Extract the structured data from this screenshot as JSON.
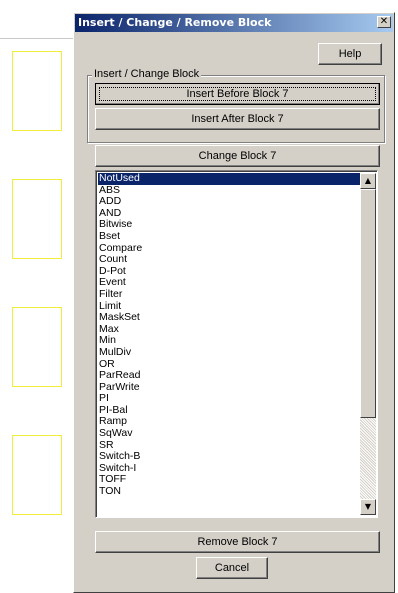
{
  "dialog": {
    "title": "Insert / Change / Remove Block",
    "close_glyph": "✕"
  },
  "buttons": {
    "help": "Help",
    "insert_before": "Insert Before Block 7",
    "insert_after": "Insert After Block 7",
    "change": "Change Block 7",
    "remove": "Remove Block 7",
    "cancel": "Cancel"
  },
  "group": {
    "label": "Insert / Change Block"
  },
  "block_list": {
    "selected": "NotUsed",
    "items": [
      "NotUsed",
      "ABS",
      "ADD",
      "AND",
      "Bitwise",
      "Bset",
      "Compare",
      "Count",
      "D-Pot",
      "Event",
      "Filter",
      "Limit",
      "MaskSet",
      "Max",
      "Min",
      "MulDiv",
      "OR",
      "ParRead",
      "ParWrite",
      "PI",
      "PI-Bal",
      "Ramp",
      "SqWav",
      "SR",
      "Switch-B",
      "Switch-I",
      "TOFF",
      "TON"
    ]
  },
  "scrollbar": {
    "up_icon": "▲",
    "down_icon": "▼"
  }
}
